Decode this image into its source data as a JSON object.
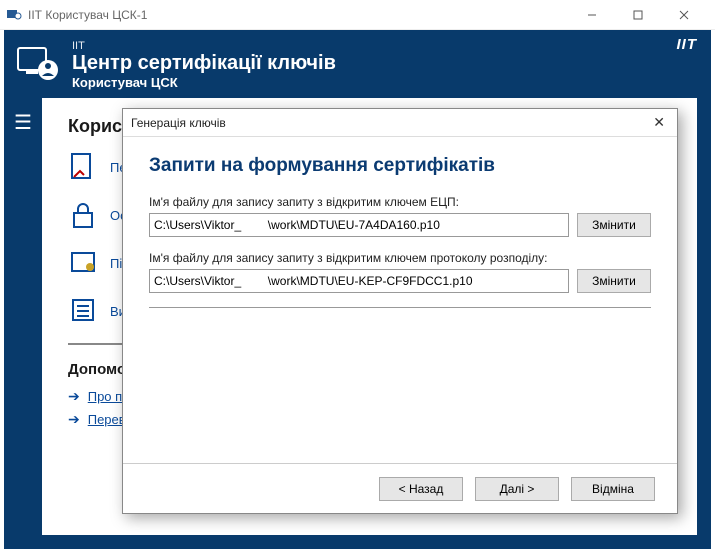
{
  "window": {
    "title": "ІІТ Користувач ЦСК-1"
  },
  "header": {
    "line1": "ІІТ",
    "line2": "Центр сертифікації ключів",
    "line3": "Користувач ЦСК",
    "brand": "IIT"
  },
  "content": {
    "heading": "Користувач",
    "rows": [
      {
        "label": "Переглянути сертифікати"
      },
      {
        "label": "Особистий ключ"
      },
      {
        "label": "Підписати"
      },
      {
        "label": "Видані сертифікати"
      }
    ],
    "help": {
      "title": "Допомога",
      "items": [
        {
          "label": "Про програму"
        },
        {
          "label": "Перевірити оновлення"
        }
      ]
    }
  },
  "dialog": {
    "title": "Генерація ключів",
    "heading": "Запити на формування сертифікатів",
    "field1": {
      "label": "Ім'я файлу для запису запиту з відкритим ключем ЕЦП:",
      "value": "C:\\Users\\Viktor_        \\work\\MDTU\\EU-7A4DA160.p10",
      "button": "Змінити"
    },
    "field2": {
      "label": "Ім'я файлу для запису запиту з відкритим ключем протоколу розподілу:",
      "value": "C:\\Users\\Viktor_        \\work\\MDTU\\EU-KEP-CF9FDCC1.p10",
      "button": "Змінити"
    },
    "buttons": {
      "back": "< Назад",
      "next": "Далі >",
      "cancel": "Відміна"
    }
  }
}
